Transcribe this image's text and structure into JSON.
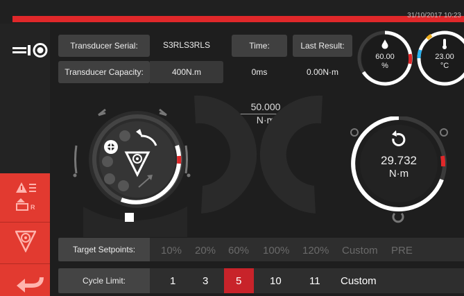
{
  "status": {
    "datetime": "31/10/2017 10:23"
  },
  "info": {
    "serial_label": "Transducer Serial:",
    "serial_value": "S3RLS3RLS",
    "capacity_label": "Transducer Capacity:",
    "capacity_value": "400N.m",
    "time_label": "Time:",
    "time_value": "0ms",
    "last_label": "Last Result:",
    "last_value": "0.00N·m"
  },
  "gauges": {
    "humidity_value": "60.00",
    "humidity_unit": "%",
    "humidity_fraction": 0.6,
    "temperature_value": "23.00",
    "temperature_unit": "°C"
  },
  "target": {
    "value": "50.000",
    "unit": "N·m"
  },
  "reading": {
    "value": "29.732",
    "unit": "N·m",
    "fraction": 0.59
  },
  "setpoints": {
    "label": "Target Setpoints:",
    "options": [
      "10%",
      "20%",
      "60%",
      "100%",
      "120%",
      "Custom",
      "PRE"
    ]
  },
  "cycle_limit": {
    "label": "Cycle Limit:",
    "options": [
      "1",
      "3",
      "5",
      "10",
      "11",
      "Custom"
    ],
    "selected": "5"
  },
  "colors": {
    "accent": "#e0282a",
    "panel": "#404040",
    "background": "#1e1e1e"
  },
  "icons": [
    "logo-icon",
    "alarm-list-icon",
    "battery-icon",
    "triangle-target-icon",
    "back-arrow-icon",
    "humidity-drop-icon",
    "thermometer-icon",
    "stop-icon",
    "reset-icon"
  ]
}
